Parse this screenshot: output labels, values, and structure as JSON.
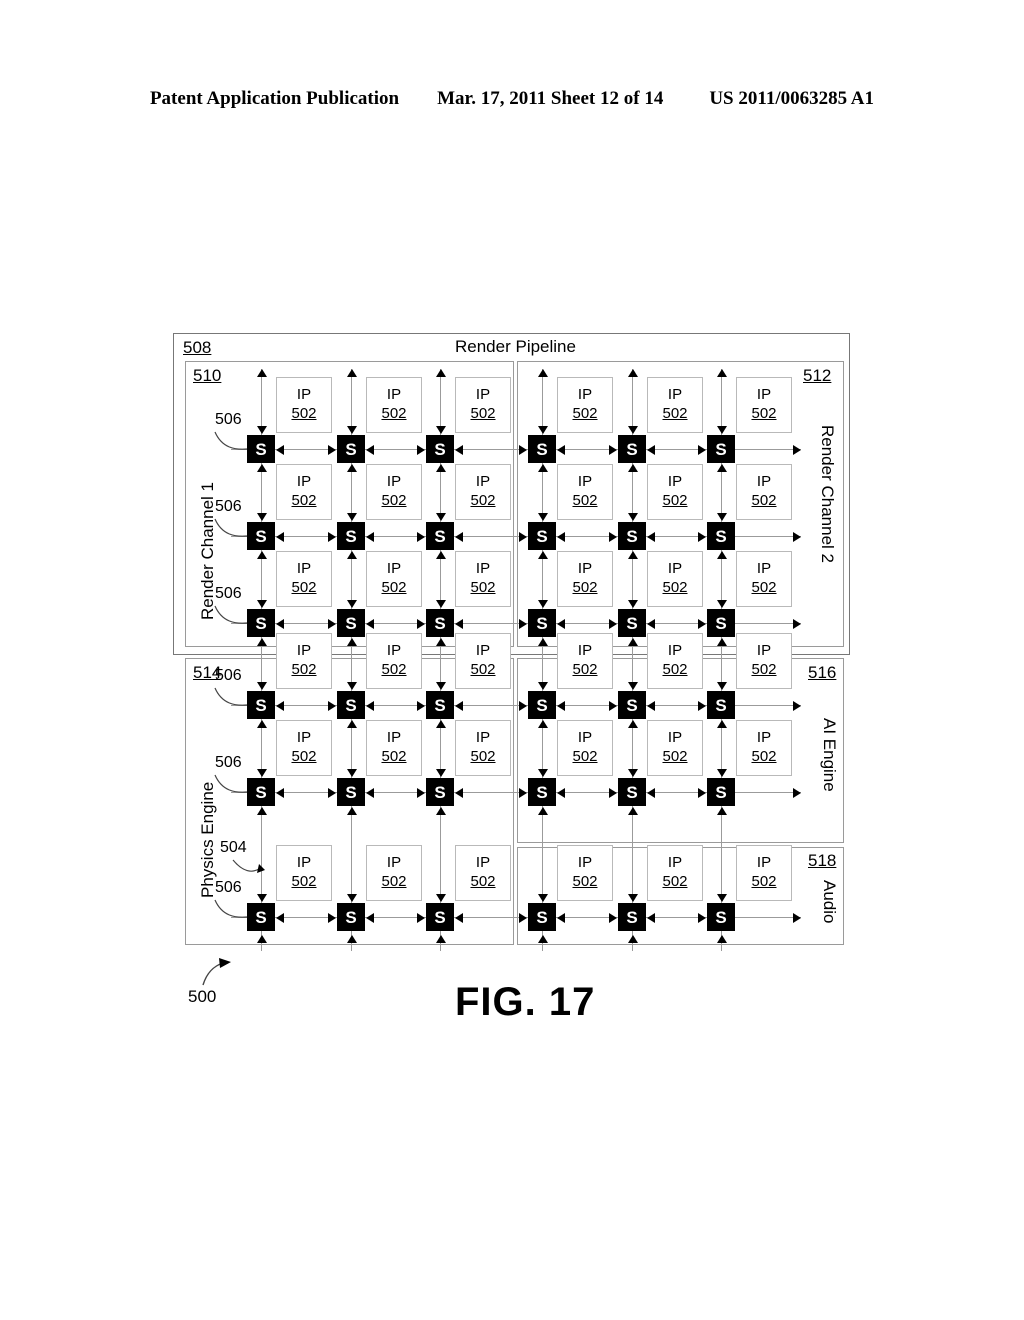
{
  "header": {
    "publication": "Patent Application Publication",
    "date_sheet": "Mar. 17, 2011  Sheet 12 of 14",
    "patent_number": "US 2011/0063285 A1"
  },
  "figure": {
    "caption": "FIG. 17",
    "system_ref": "500",
    "link_ref": "504",
    "switch_ref": "506",
    "ip_label": "IP",
    "ip_ref": "502",
    "switch_label": "S",
    "outer": {
      "ref": "508",
      "title": "Render Pipeline"
    },
    "regions": [
      {
        "ref": "510",
        "title": "Render Channel 1",
        "rows": 3,
        "cols": 3,
        "orientation": "up"
      },
      {
        "ref": "512",
        "title": "Render Channel 2",
        "rows": 3,
        "cols": 3,
        "orientation": "down"
      },
      {
        "ref": "514",
        "title": "Physics Engine",
        "rows": 3,
        "cols": 3,
        "orientation": "up"
      },
      {
        "ref": "516",
        "title": "AI Engine",
        "rows": 2,
        "cols": 3,
        "orientation": "down"
      },
      {
        "ref": "518",
        "title": "Audio",
        "rows": 1,
        "cols": 3,
        "orientation": "down"
      }
    ],
    "switch_callout_labels": [
      "506",
      "506",
      "506",
      "506",
      "506",
      "506"
    ],
    "colors": {
      "switch_fill": "#000000",
      "ip_border": "#b9b9b9",
      "link": "#9b9b9b",
      "box_border": "#777777"
    }
  }
}
